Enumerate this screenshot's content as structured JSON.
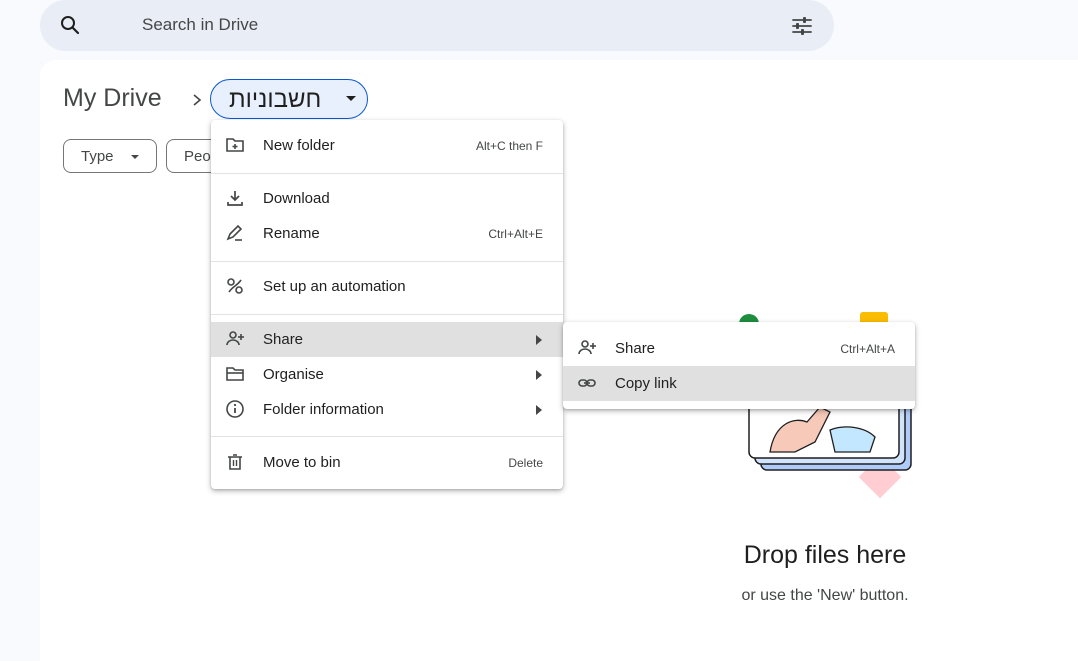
{
  "search": {
    "placeholder": "Search in Drive"
  },
  "breadcrumb": {
    "root": "My Drive",
    "current": "חשבוניות"
  },
  "filters": [
    {
      "label": "Type"
    },
    {
      "label": "Peo"
    }
  ],
  "context_menu": {
    "items": [
      {
        "label": "New folder",
        "shortcut": "Alt+C then F",
        "icon": "new-folder-icon"
      },
      {
        "label": "Download",
        "icon": "download-icon"
      },
      {
        "label": "Rename",
        "shortcut": "Ctrl+Alt+E",
        "icon": "rename-icon"
      },
      {
        "label": "Set up an automation",
        "icon": "automation-icon"
      },
      {
        "label": "Share",
        "icon": "share-icon",
        "submenu": true
      },
      {
        "label": "Organise",
        "icon": "organise-icon",
        "submenu": true
      },
      {
        "label": "Folder information",
        "icon": "info-icon",
        "submenu": true
      },
      {
        "label": "Move to bin",
        "shortcut": "Delete",
        "icon": "bin-icon"
      }
    ]
  },
  "share_submenu": {
    "items": [
      {
        "label": "Share",
        "shortcut": "Ctrl+Alt+A",
        "icon": "share-icon"
      },
      {
        "label": "Copy link",
        "icon": "link-icon"
      }
    ]
  },
  "empty_state": {
    "title": "Drop files here",
    "subtitle": "or use the 'New' button."
  },
  "colors": {
    "accent": "#0b57d0",
    "chip_bg": "#e8f0fe",
    "search_bg": "#e9eef6",
    "hover": "#e0e0e0"
  }
}
